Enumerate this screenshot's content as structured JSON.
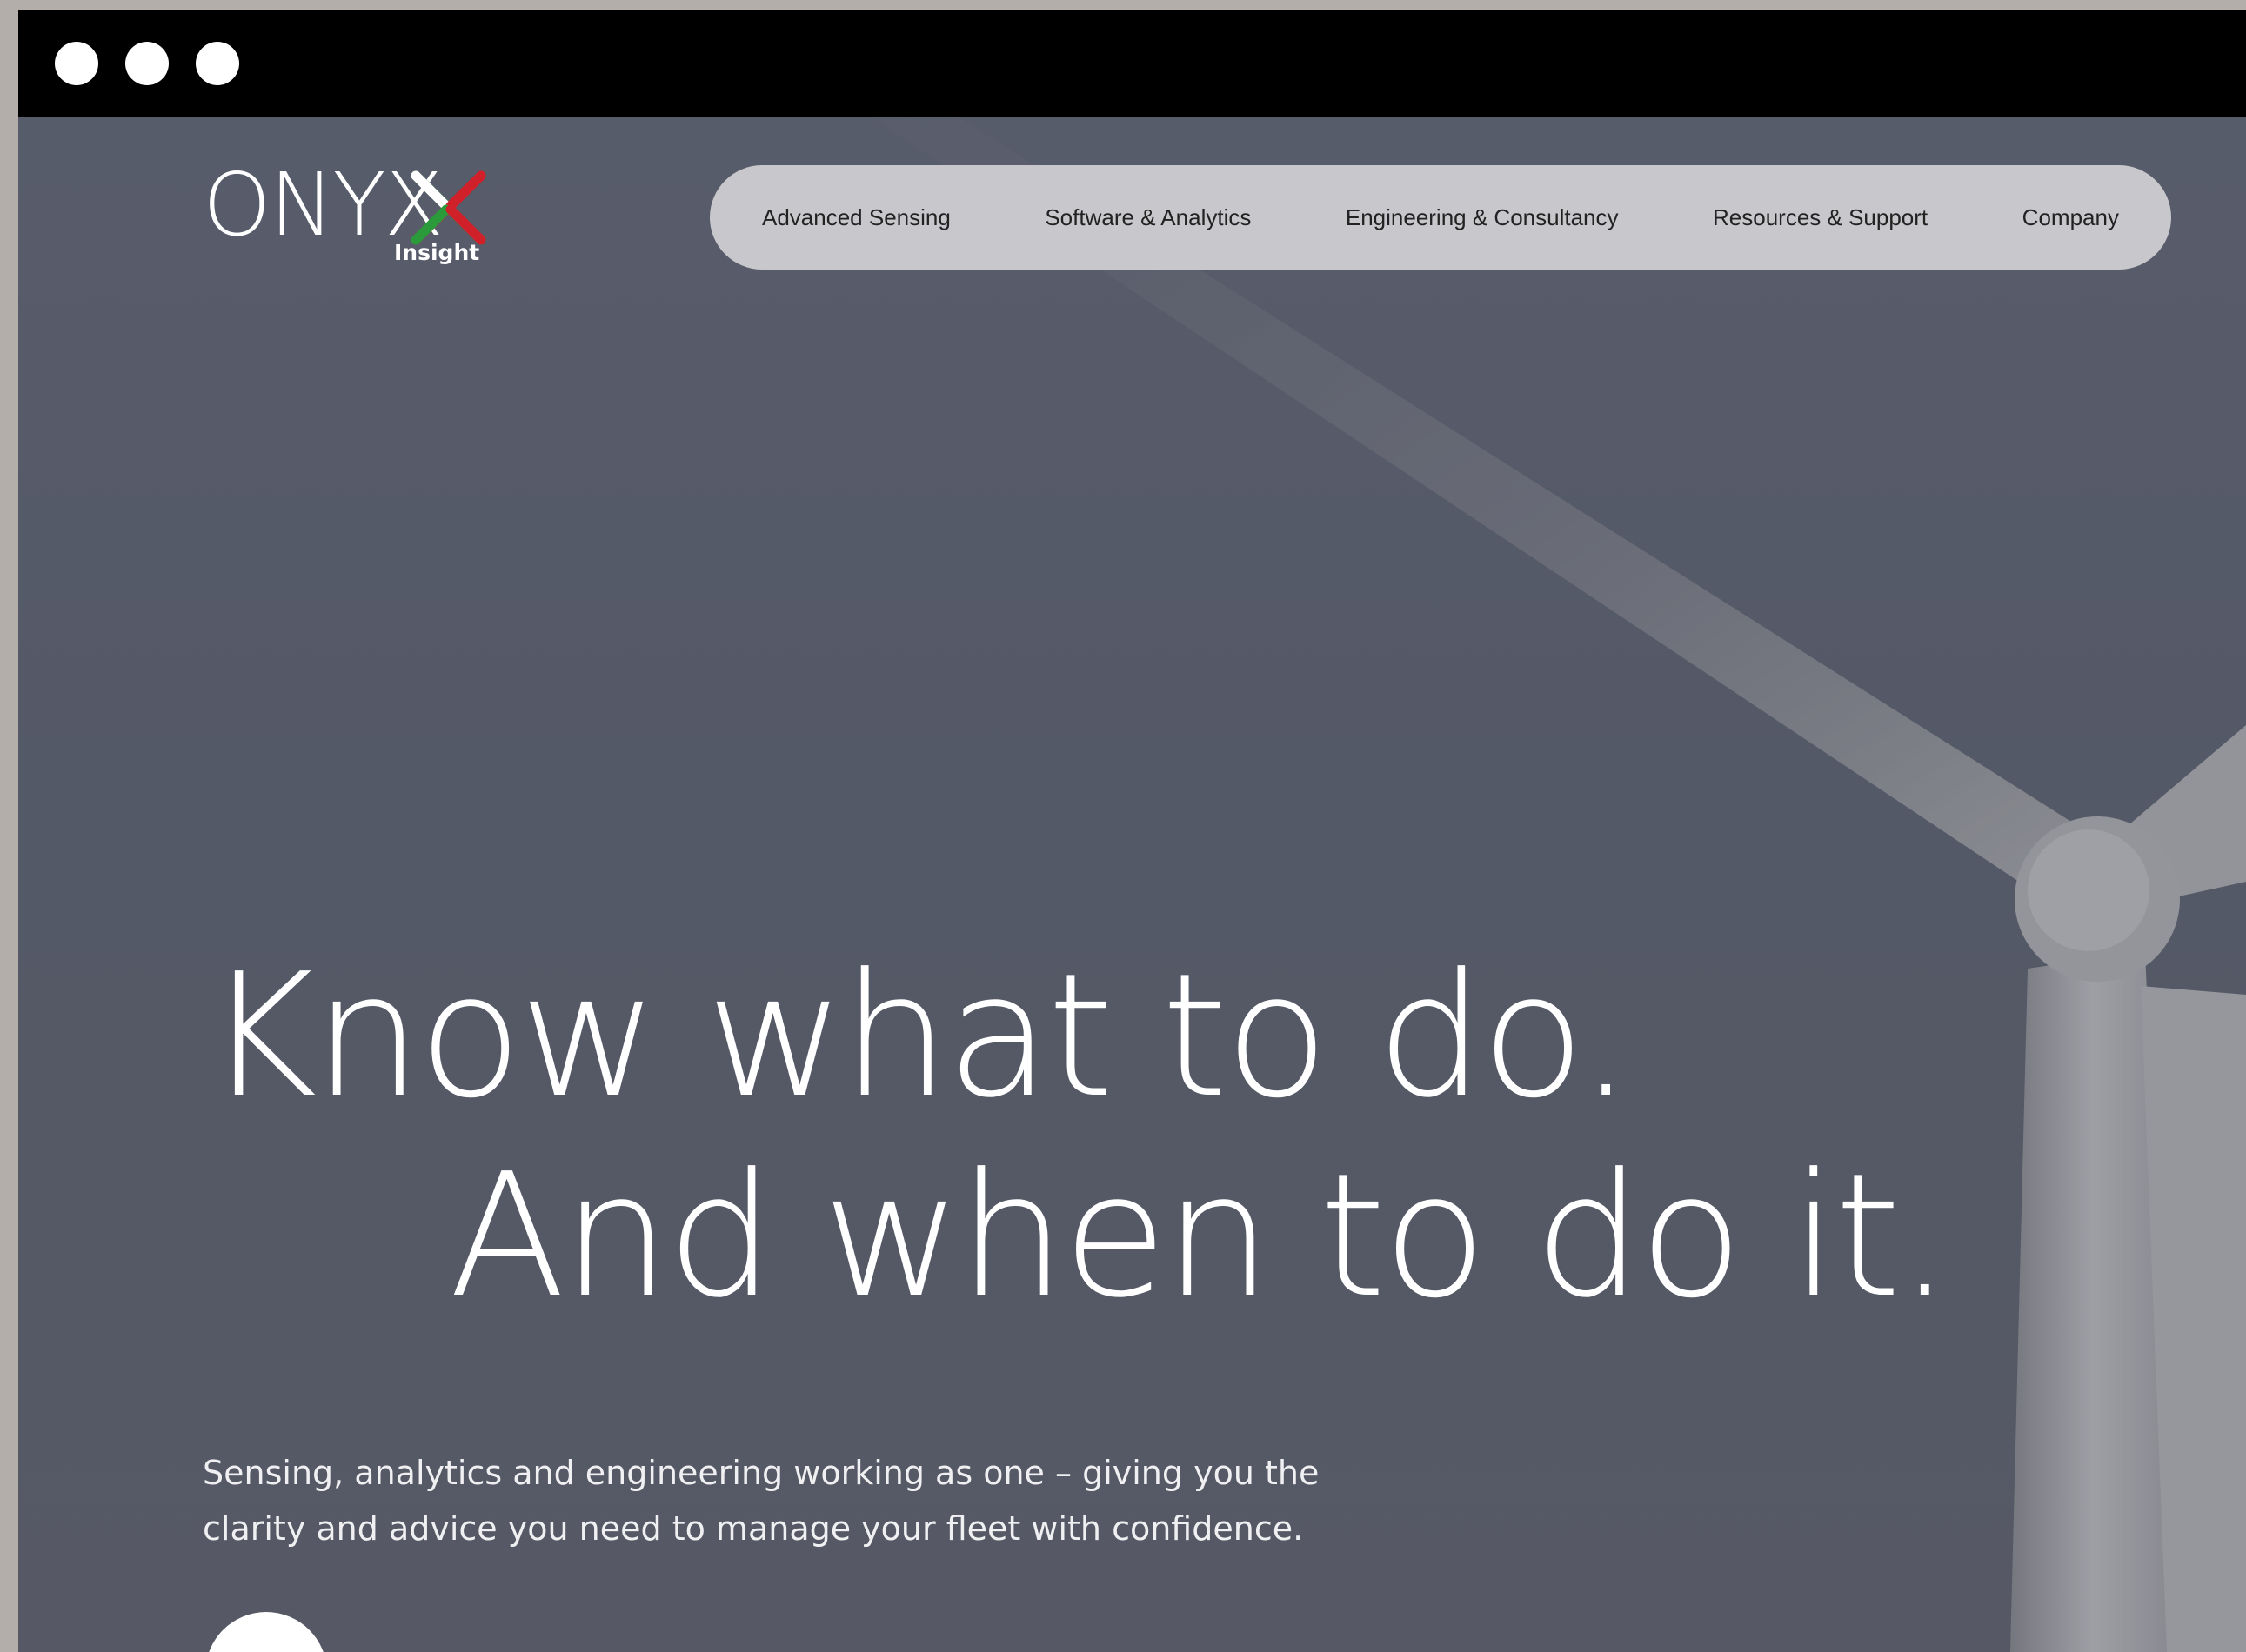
{
  "window": {
    "controls": [
      "close-dot",
      "minimize-dot",
      "maximize-dot"
    ]
  },
  "brand": {
    "name": "ONYX",
    "sub": "Insight",
    "accent_colors": [
      "#2a9a3a",
      "#d0202a"
    ]
  },
  "nav": {
    "items": [
      {
        "label": "Advanced Sensing"
      },
      {
        "label": "Software & Analytics"
      },
      {
        "label": "Engineering & Consultancy"
      },
      {
        "label": "Resources & Support"
      },
      {
        "label": "Company"
      }
    ]
  },
  "hero": {
    "headline_line1": "Know what to do.",
    "headline_line2": "And when to do it.",
    "subtext_line1": "Sensing, analytics and engineering working as one – giving you the",
    "subtext_line2": "clarity and advice you need to manage your fleet with confidence.",
    "scroll_icon": "scroll-down-icon"
  }
}
